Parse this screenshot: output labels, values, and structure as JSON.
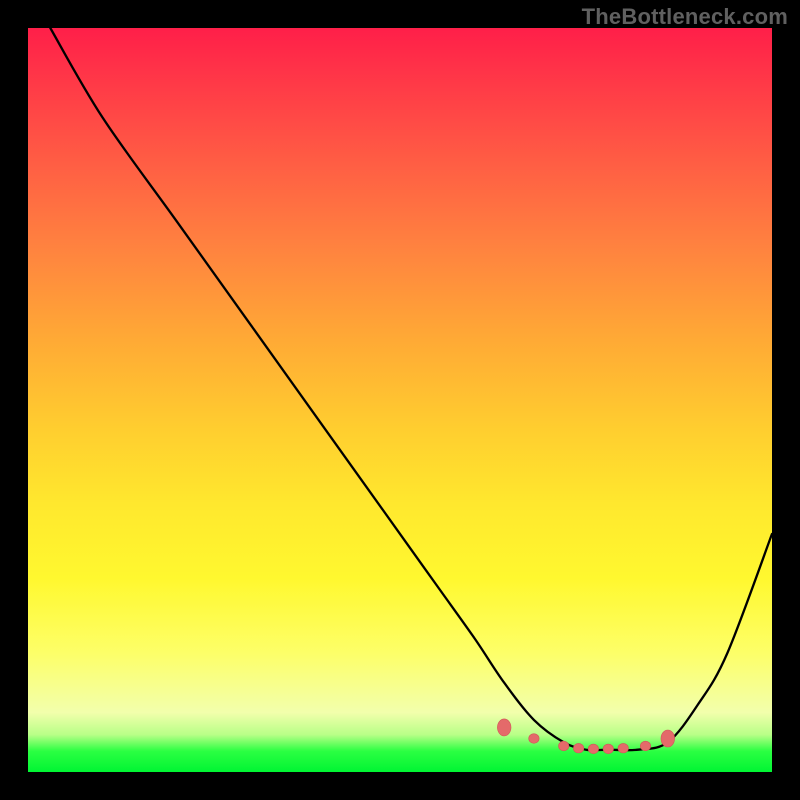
{
  "attribution": "TheBottleneck.com",
  "colors": {
    "page_bg": "#000000",
    "attribution_text": "#606060",
    "curve_stroke": "#000000",
    "marker_fill": "#e46a6a",
    "gradient_top": "#ff1f49",
    "gradient_bottom": "#00f533"
  },
  "chart_data": {
    "type": "line",
    "title": "",
    "xlabel": "",
    "ylabel": "",
    "xlim": [
      0,
      100
    ],
    "ylim": [
      0,
      100
    ],
    "grid": false,
    "series": [
      {
        "name": "bottleneck-curve",
        "x": [
          3,
          10,
          20,
          30,
          40,
          50,
          55,
          60,
          64,
          68,
          72,
          75,
          78,
          82,
          86,
          90,
          94,
          100
        ],
        "y": [
          100,
          88,
          74,
          60,
          46,
          32,
          25,
          18,
          12,
          7,
          4,
          3,
          3,
          3,
          4,
          9,
          16,
          32
        ]
      }
    ],
    "markers": {
      "name": "optimal-range",
      "x": [
        64,
        68,
        72,
        74,
        76,
        78,
        80,
        83,
        86
      ],
      "y": [
        6,
        4.5,
        3.5,
        3.2,
        3.1,
        3.1,
        3.2,
        3.5,
        4.5
      ]
    },
    "notes": "y measured as percent of chart height from bottom; curve descends from top-left, reaches minimum ~x=76, rises toward top-right; no axes or tick labels visible",
    "background": "vertical gradient red→yellow→green"
  }
}
